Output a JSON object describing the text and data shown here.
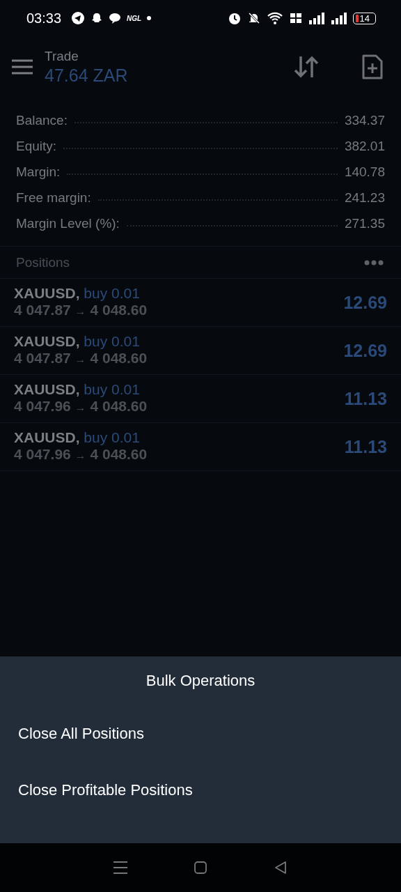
{
  "status_bar": {
    "time": "03:33",
    "app_badge": "NGL",
    "battery": "14"
  },
  "header": {
    "title": "Trade",
    "subtitle": "47.64 ZAR"
  },
  "summary": [
    {
      "label": "Balance:",
      "value": "334.37"
    },
    {
      "label": "Equity:",
      "value": "382.01"
    },
    {
      "label": "Margin:",
      "value": "140.78"
    },
    {
      "label": "Free margin:",
      "value": "241.23"
    },
    {
      "label": "Margin Level (%):",
      "value": "271.35"
    }
  ],
  "positions_header": "Positions",
  "positions": [
    {
      "symbol": "XAUUSD,",
      "order": "buy 0.01",
      "open": "4 047.87",
      "arrow": "→",
      "current": "4 048.60",
      "profit": "12.69"
    },
    {
      "symbol": "XAUUSD,",
      "order": "buy 0.01",
      "open": "4 047.87",
      "arrow": "→",
      "current": "4 048.60",
      "profit": "12.69"
    },
    {
      "symbol": "XAUUSD,",
      "order": "buy 0.01",
      "open": "4 047.96",
      "arrow": "→",
      "current": "4 048.60",
      "profit": "11.13"
    },
    {
      "symbol": "XAUUSD,",
      "order": "buy 0.01",
      "open": "4 047.96",
      "arrow": "→",
      "current": "4 048.60",
      "profit": "11.13"
    }
  ],
  "sheet": {
    "title": "Bulk Operations",
    "items": [
      "Close All Positions",
      "Close Profitable Positions"
    ]
  }
}
